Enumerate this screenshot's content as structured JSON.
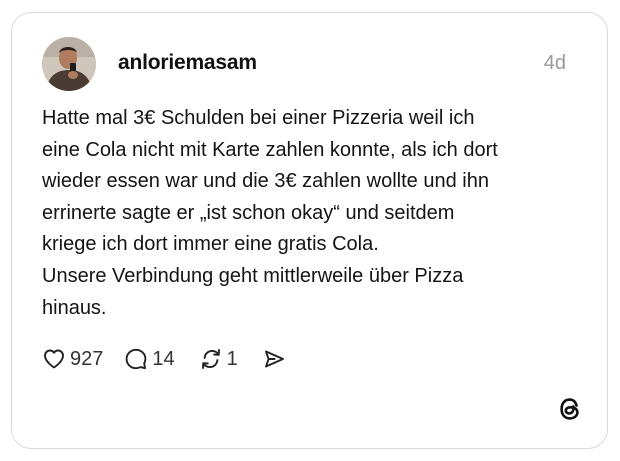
{
  "post": {
    "username": "anloriemasam",
    "timestamp": "4d",
    "lines": [
      "Hatte mal 3€ Schulden bei einer Pizzeria weil ich",
      "eine Cola nicht mit Karte zahlen konnte, als ich dort",
      "wieder essen war und die 3€ zahlen wollte und ihn",
      "errinerte sagte er „ist schon okay“ und seitdem",
      "kriege ich dort immer eine gratis Cola.",
      "Unsere Verbindung geht mittlerweile über Pizza",
      "hinaus."
    ]
  },
  "actions": {
    "likes": "927",
    "replies": "14",
    "reposts": "1"
  },
  "icons": {
    "like": "heart-icon",
    "reply": "comment-bubble-icon",
    "repost": "repost-icon",
    "share": "send-icon",
    "brand": "threads-logo-icon"
  }
}
